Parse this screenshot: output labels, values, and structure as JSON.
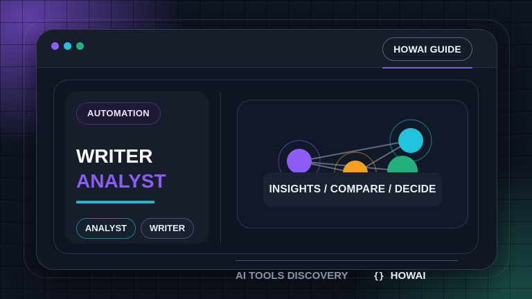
{
  "header": {
    "guide_label": "HOWAI GUIDE"
  },
  "left_card": {
    "badge": "AUTOMATION",
    "title_line1": "WRITER",
    "title_line2": "ANALYST",
    "tags": [
      "ANALYST",
      "WRITER"
    ]
  },
  "right_card": {
    "caption": "INSIGHTS / COMPARE / DECIDE"
  },
  "footer": {
    "discovery": "AI TOOLS DISCOVERY",
    "brand_icon": "{}",
    "brand": "HOWAI"
  },
  "colors": {
    "purple": "#8b5cf6",
    "cyan": "#22c3dd",
    "green": "#22b07d",
    "orange": "#f2a11f",
    "background": "#0e1420"
  },
  "icons": [
    "window-dot-purple",
    "window-dot-cyan",
    "window-dot-green",
    "braces-icon"
  ]
}
